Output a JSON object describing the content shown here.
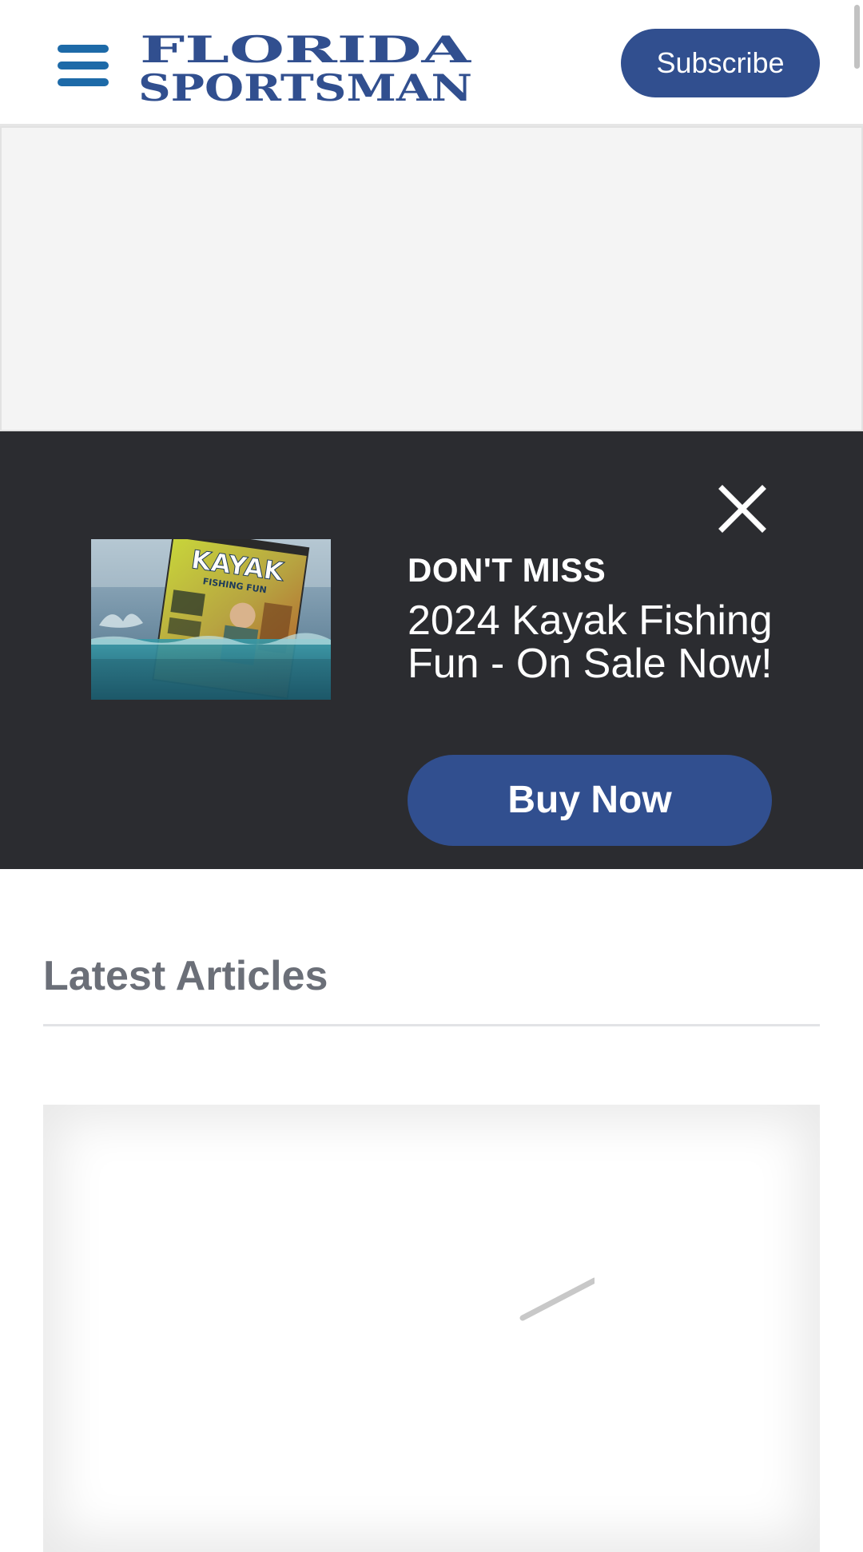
{
  "header": {
    "menu_icon": "hamburger-menu-icon",
    "logo_line1": "FLORIDA",
    "logo_line2": "SPORTSMAN",
    "subscribe_label": "Subscribe",
    "brand_color": "#314f8f",
    "menu_color": "#1d6aa8"
  },
  "promo": {
    "kicker": "DON'T MISS",
    "title": "2024 Kayak Fishing Fun - On Sale Now!",
    "button_label": "Buy Now",
    "close_icon": "close-icon",
    "magazine_cover_text": "KAYAK",
    "magazine_subtitle": "FISHING FUN",
    "background_color": "#2b2c30"
  },
  "articles": {
    "section_title": "Latest Articles",
    "loading_icon": "loading-spinner-icon"
  }
}
